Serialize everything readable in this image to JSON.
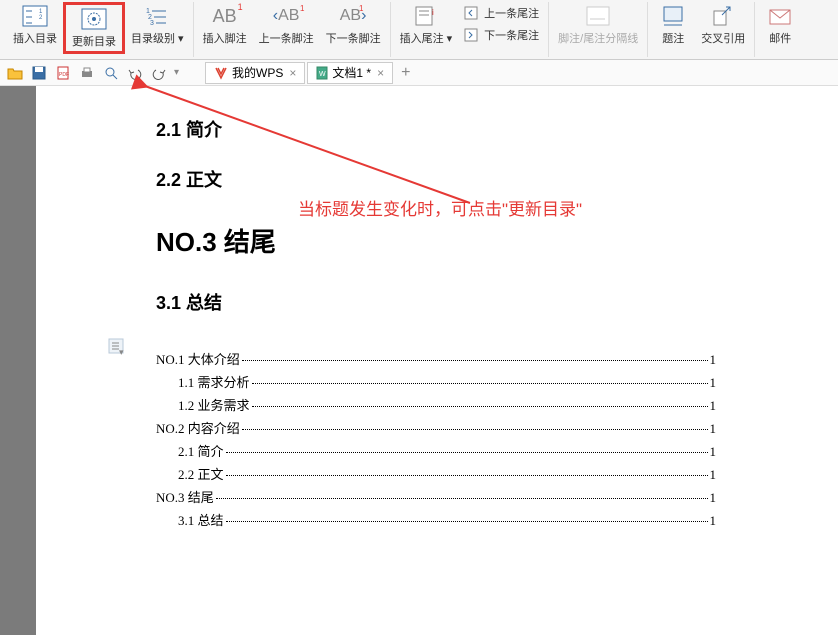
{
  "ribbon": {
    "insertToc": "插入目录",
    "updateToc": "更新目录",
    "tocLevel": "目录级别",
    "insertFootnote": "插入脚注",
    "prevFootnote": "上一条脚注",
    "nextFootnote": "下一条脚注",
    "insertEndnote": "插入尾注",
    "prevEndnote": "上一条尾注",
    "nextEndnote": "下一条尾注",
    "fnSeparator": "脚注/尾注分隔线",
    "caption": "题注",
    "crossRef": "交叉引用",
    "mail": "邮件"
  },
  "tabs": {
    "wps": "我的WPS",
    "doc": "文档1 *"
  },
  "document": {
    "headings": {
      "h21": "2.1 简介",
      "h22": "2.2 正文",
      "no3": "NO.3 结尾",
      "h31": "3.1 总结"
    },
    "toc": [
      {
        "text": "NO.1 大体介绍",
        "page": "1",
        "indent": 0
      },
      {
        "text": "1.1 需求分析",
        "page": "1",
        "indent": 1
      },
      {
        "text": "1.2 业务需求",
        "page": "1",
        "indent": 1
      },
      {
        "text": "NO.2 内容介绍",
        "page": "1",
        "indent": 0
      },
      {
        "text": "2.1 简介",
        "page": "1",
        "indent": 1
      },
      {
        "text": "2.2 正文",
        "page": "1",
        "indent": 1
      },
      {
        "text": "NO.3 结尾",
        "page": "1",
        "indent": 0
      },
      {
        "text": "3.1 总结",
        "page": "1",
        "indent": 1
      }
    ]
  },
  "annotation": "当标题发生变化时，可点击\"更新目录\""
}
